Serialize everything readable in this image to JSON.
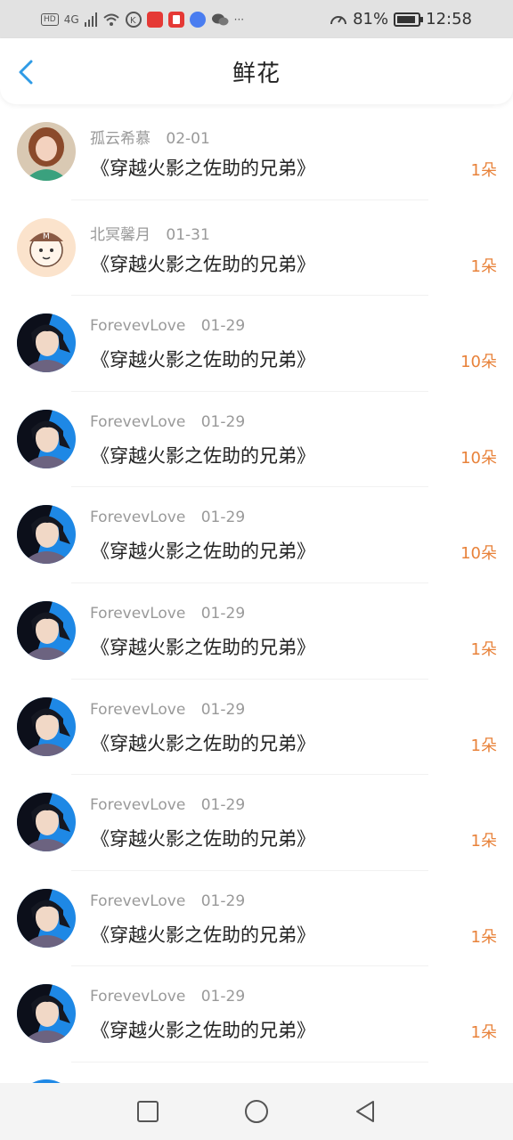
{
  "status": {
    "battery": "81%",
    "time": "12:58",
    "network": "4G",
    "hd": "HD"
  },
  "header": {
    "title": "鲜花"
  },
  "rows": [
    {
      "name": "孤云希慕",
      "date": "02-01",
      "book": "《穿越火影之佐助的兄弟》",
      "count": "1朵",
      "avatar": "avatar-girl"
    },
    {
      "name": "北冥馨月",
      "date": "01-31",
      "book": "《穿越火影之佐助的兄弟》",
      "count": "1朵",
      "avatar": "avatar-cartoon"
    },
    {
      "name": "ForevevLove",
      "date": "01-29",
      "book": "《穿越火影之佐助的兄弟》",
      "count": "10朵",
      "avatar": "avatar-anime"
    },
    {
      "name": "ForevevLove",
      "date": "01-29",
      "book": "《穿越火影之佐助的兄弟》",
      "count": "10朵",
      "avatar": "avatar-anime"
    },
    {
      "name": "ForevevLove",
      "date": "01-29",
      "book": "《穿越火影之佐助的兄弟》",
      "count": "10朵",
      "avatar": "avatar-anime"
    },
    {
      "name": "ForevevLove",
      "date": "01-29",
      "book": "《穿越火影之佐助的兄弟》",
      "count": "1朵",
      "avatar": "avatar-anime"
    },
    {
      "name": "ForevevLove",
      "date": "01-29",
      "book": "《穿越火影之佐助的兄弟》",
      "count": "1朵",
      "avatar": "avatar-anime"
    },
    {
      "name": "ForevevLove",
      "date": "01-29",
      "book": "《穿越火影之佐助的兄弟》",
      "count": "1朵",
      "avatar": "avatar-anime"
    },
    {
      "name": "ForevevLove",
      "date": "01-29",
      "book": "《穿越火影之佐助的兄弟》",
      "count": "1朵",
      "avatar": "avatar-anime"
    },
    {
      "name": "ForevevLove",
      "date": "01-29",
      "book": "《穿越火影之佐助的兄弟》",
      "count": "1朵",
      "avatar": "avatar-anime"
    }
  ],
  "colors": {
    "accent": "#e8823a",
    "back": "#2f9be6",
    "meta": "#999999"
  },
  "icons": {
    "back": "chevron-left-icon",
    "nav": [
      "square-icon",
      "circle-icon",
      "triangle-back-icon"
    ]
  }
}
